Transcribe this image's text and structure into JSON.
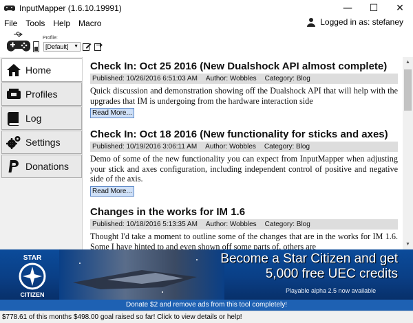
{
  "window": {
    "title": "InputMapper (1.6.10.19991)",
    "minimize": "—",
    "maximize": "☐",
    "close": "✕"
  },
  "menu": {
    "items": [
      "File",
      "Tools",
      "Help",
      "Macro"
    ],
    "login_text": "Logged in as: stefaney"
  },
  "toolbar": {
    "profile_label": "Profile:",
    "profile_value": "[Default]"
  },
  "sidebar": {
    "items": [
      {
        "label": "Home",
        "icon": "home-icon",
        "active": true
      },
      {
        "label": "Profiles",
        "icon": "profiles-icon",
        "active": false
      },
      {
        "label": "Log",
        "icon": "log-icon",
        "active": false
      },
      {
        "label": "Settings",
        "icon": "settings-icon",
        "active": false
      },
      {
        "label": "Donations",
        "icon": "paypal-icon",
        "active": false
      }
    ]
  },
  "posts": [
    {
      "title": "Check In: Oct 25 2016 (New Dualshock API almost complete)",
      "published": "Published: 10/26/2016 6:51:03 AM",
      "author": "Author: Wobbles",
      "category": "Category: Blog",
      "body": "Quick discussion and demonstration showing off the Dualshock API that will help with the upgrades that IM is undergoing from the hardware interaction side",
      "read_more": "Read More..."
    },
    {
      "title": "Check In: Oct 18 2016 (New functionality for sticks and axes)",
      "published": "Published: 10/19/2016 3:06:11 AM",
      "author": "Author: Wobbles",
      "category": "Category: Blog",
      "body": "Demo of some of the new functionality you can expect from InputMapper when adjusting your stick and axes configuration, including independent control of positive and negative side of the axis.",
      "read_more": "Read More..."
    },
    {
      "title": "Changes in the works for IM 1.6",
      "published": "Published: 10/18/2016 5:13:35 AM",
      "author": "Author: Wobbles",
      "category": "Category: Blog",
      "body": "Thought I'd take a moment to outline some of the changes that are in the works for IM 1.6. Some I have hinted to and even shown off some parts of, others are"
    }
  ],
  "banner": {
    "logo_top": "STAR",
    "logo_bottom": "CITIZEN",
    "line1": "Become a Star Citizen and get",
    "line2": "5,000 free UEC credits",
    "small": "Playable alpha 2.5 now available"
  },
  "donate_bar": "Donate $2 and remove ads from this tool completely!",
  "status_bar": "$778.61 of this months $498.00 goal raised so far!  Click to view details or help!",
  "colors": {
    "banner_blue": "#0b4b9a",
    "donate_blue": "#1e61b3",
    "read_more_bg": "#cfe0f7",
    "meta_bg": "#dddddd"
  }
}
